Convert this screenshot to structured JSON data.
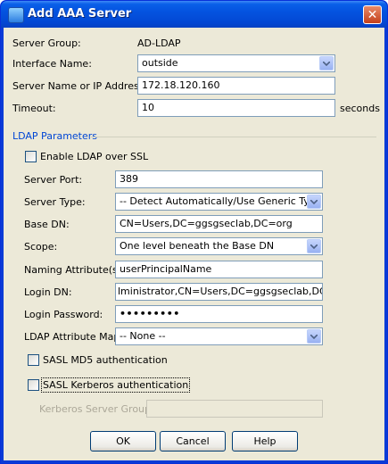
{
  "window": {
    "title": "Add AAA Server",
    "close_glyph": "✕"
  },
  "server_group": {
    "label": "Server Group:",
    "value": "AD-LDAP"
  },
  "interface": {
    "label": "Interface Name:",
    "value": "outside"
  },
  "server_name": {
    "label": "Server Name or IP Address:",
    "value": "172.18.120.160"
  },
  "timeout": {
    "label": "Timeout:",
    "value": "10",
    "unit": "seconds"
  },
  "ldap": {
    "section_title": "LDAP Parameters",
    "enable_ssl": {
      "label": "Enable LDAP over SSL",
      "checked": false
    },
    "server_port": {
      "label": "Server Port:",
      "value": "389"
    },
    "server_type": {
      "label": "Server Type:",
      "value": "-- Detect Automatically/Use Generic Type --"
    },
    "base_dn": {
      "label": "Base DN:",
      "value": "CN=Users,DC=ggsgseclab,DC=org"
    },
    "scope": {
      "label": "Scope:",
      "value": "One level beneath the Base DN"
    },
    "naming_attribute": {
      "label": "Naming Attribute(s):",
      "value": "userPrincipalName"
    },
    "login_dn": {
      "label": "Login DN:",
      "value": "lministrator,CN=Users,DC=ggsgseclab,DC=org"
    },
    "login_password": {
      "label": "Login Password:",
      "value": "•••••••••"
    },
    "attribute_map": {
      "label": "LDAP Attribute Map:",
      "value": "-- None --"
    },
    "sasl_md5": {
      "label": "SASL MD5 authentication",
      "checked": false
    },
    "sasl_kerberos": {
      "label": "SASL Kerberos authentication",
      "checked": false
    },
    "kerberos_group": {
      "label": "Kerberos Server Group:",
      "value": ""
    }
  },
  "buttons": {
    "ok": "OK",
    "cancel": "Cancel",
    "help": "Help"
  },
  "colors": {
    "title_bar": "#0453e0",
    "section_title": "#0046d5",
    "dialog_bg": "#ece9d8"
  }
}
